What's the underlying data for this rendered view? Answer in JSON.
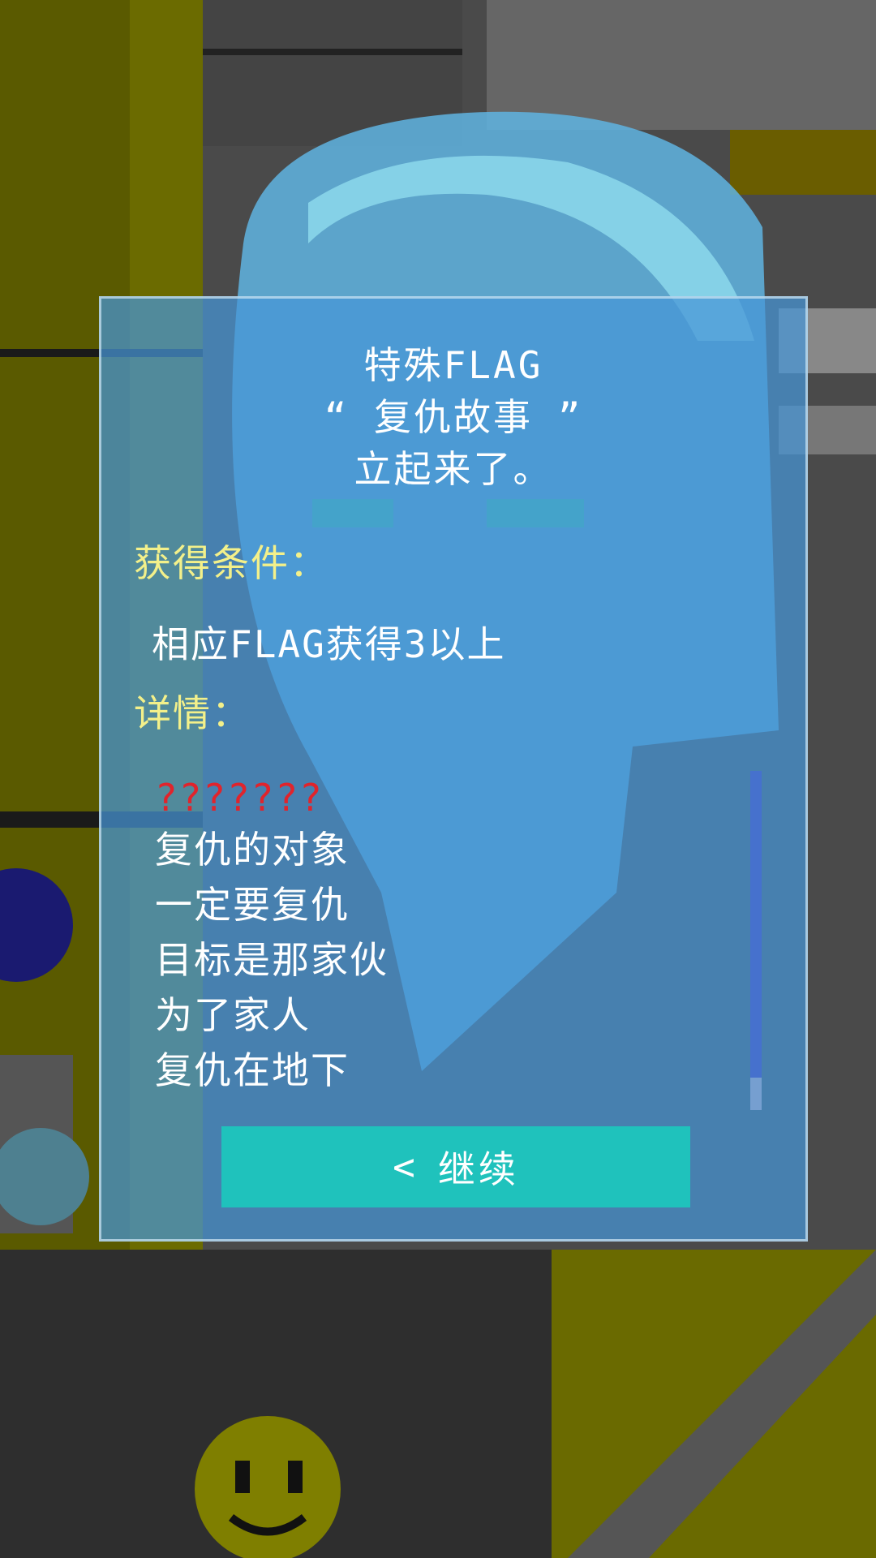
{
  "dialog": {
    "title_lines": [
      "特殊FLAG",
      "“ 复仇故事 ”",
      "立起来了。"
    ],
    "condition_label": "获得条件：",
    "condition_text": "相应FLAG获得3以上",
    "details_label": "详情：",
    "details_unknown": "???????",
    "details_lines": [
      "复仇的对象",
      "一定要复仇",
      "目标是那家伙",
      "为了家人",
      "复仇在地下"
    ],
    "continue_label": "继续",
    "continue_icon": "chevron-left-icon"
  }
}
